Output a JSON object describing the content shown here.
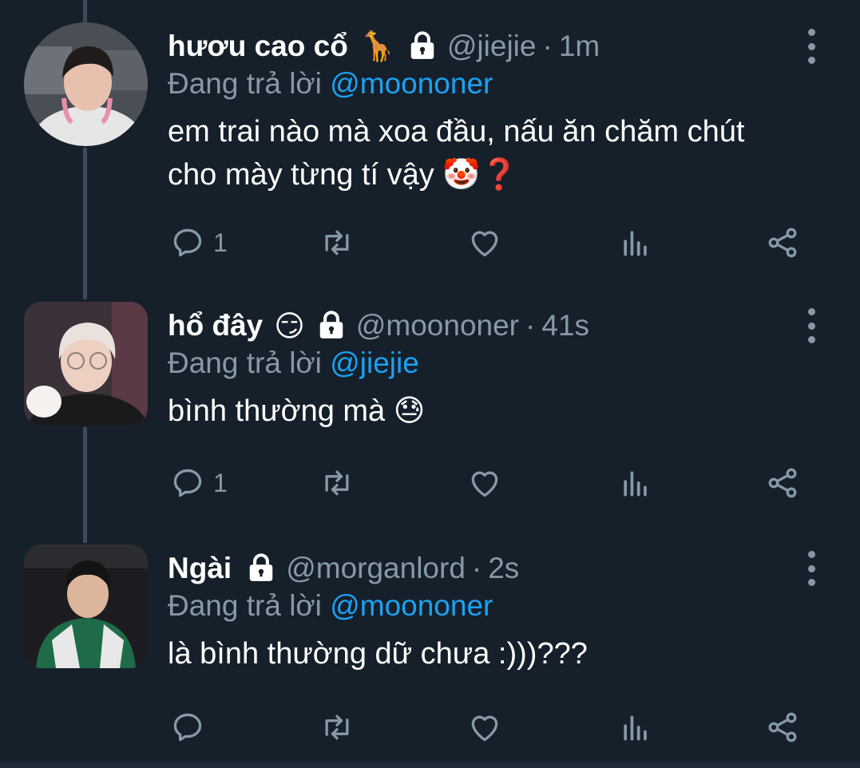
{
  "tweets": [
    {
      "name": "hươu cao cổ",
      "name_emoji": "🦒",
      "handle": "@jiejie",
      "separator": "·",
      "time": "1m",
      "reply_prefix": "Đang trả lời",
      "reply_to": "@moononer",
      "body_line1": "em trai nào mà xoa đầu, nấu ăn chăm chút",
      "body_line2": "cho mày từng tí vậy 🤡❓",
      "reply_count": "1"
    },
    {
      "name": "hổ đây",
      "name_emoji": "😏",
      "handle": "@moononer",
      "separator": "·",
      "time": "41s",
      "reply_prefix": "Đang trả lời",
      "reply_to": "@jiejie",
      "body_line1": "bình thường mà 😓",
      "reply_count": "1"
    },
    {
      "name": "Ngài",
      "handle": "@morganlord",
      "separator": "·",
      "time": "2s",
      "reply_prefix": "Đang trả lời",
      "reply_to": "@moononer",
      "body_line1": "là bình thường dữ chưa :)))???"
    }
  ],
  "icons": [
    "reply-icon",
    "retweet-icon",
    "like-icon",
    "analytics-icon",
    "share-icon",
    "lock-icon",
    "more-icon"
  ],
  "colors": {
    "background": "#15202b",
    "muted": "#8899a6",
    "accent": "#1da1f2",
    "text": "#ffffff"
  }
}
